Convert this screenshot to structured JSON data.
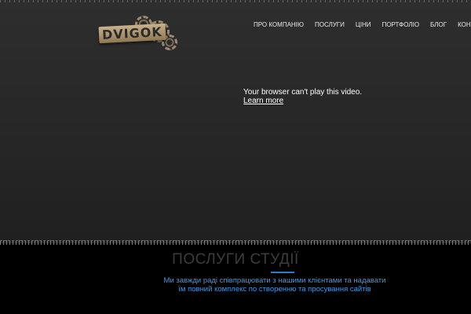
{
  "header": {
    "logo_text": "DVIGOK",
    "nav": [
      {
        "label": "ПРО КОМПАНІЮ"
      },
      {
        "label": "ПОСЛУГИ"
      },
      {
        "label": "ЦІНИ"
      },
      {
        "label": "ПОРТФОЛІО"
      },
      {
        "label": "БЛОГ"
      },
      {
        "label": "КОНТАКТИ"
      }
    ]
  },
  "video": {
    "message": "Your browser can't play this video.",
    "link_label": "Learn more"
  },
  "services": {
    "title": "ПОСЛУГИ СТУДІЇ",
    "text_line1": "Ми завжди раді співпрацювати з нашими клієнтами та надавати",
    "text_line2": "їм повний комплекс по створенню та просування сайтів"
  },
  "colors": {
    "accent": "#3d9be8",
    "underline": "#2a7ec8",
    "hero_bg": "#2a2a2a"
  }
}
